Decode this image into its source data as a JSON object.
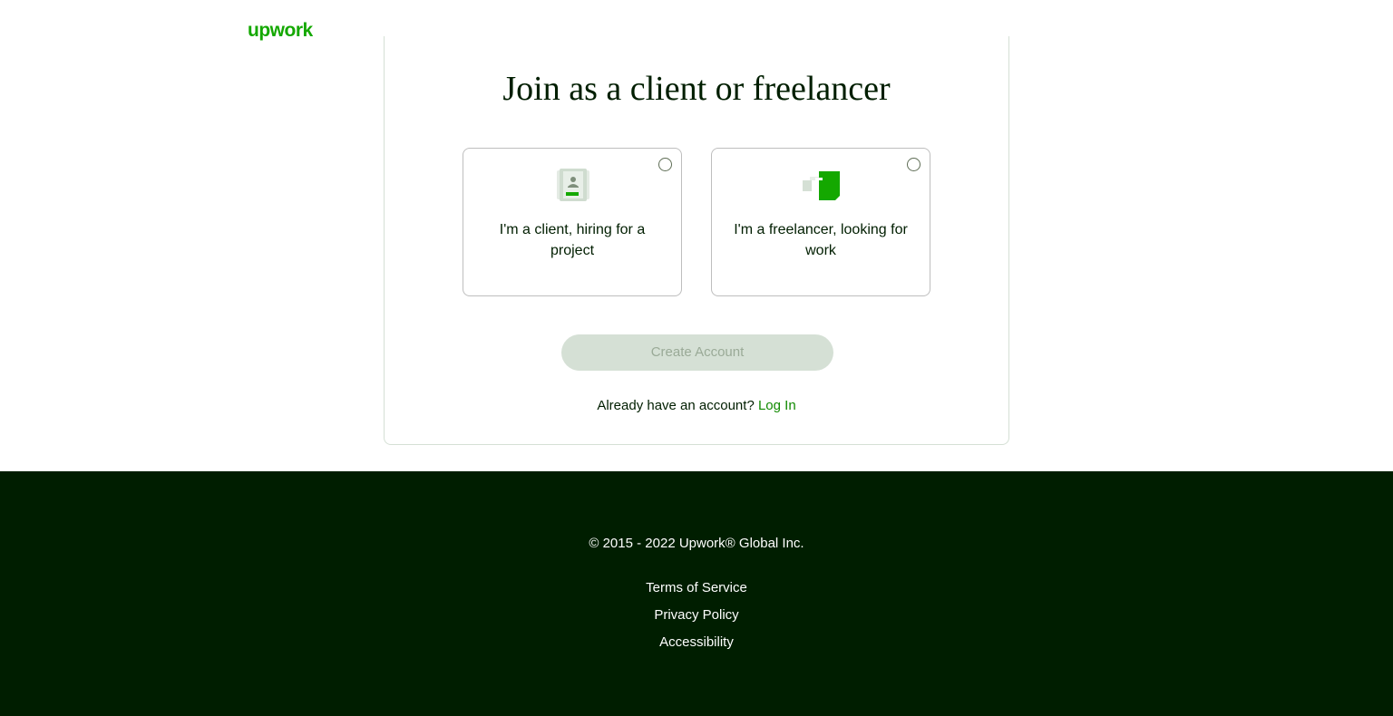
{
  "header": {
    "logo_text": "upwork"
  },
  "main": {
    "title": "Join as a client or freelancer",
    "options": [
      {
        "label": "I'm a client, hiring for a project",
        "icon": "client-briefcase-icon",
        "selected": false
      },
      {
        "label": "I'm a freelancer, looking for work",
        "icon": "freelancer-work-icon",
        "selected": false
      }
    ],
    "create_account_label": "Create Account",
    "login_prompt": "Already have an account?",
    "login_link": "Log In"
  },
  "footer": {
    "copyright": "© 2015 - 2022 Upwork® Global Inc.",
    "links": [
      "Terms of Service",
      "Privacy Policy",
      "Accessibility"
    ]
  },
  "colors": {
    "brand_green": "#14a800",
    "footer_bg": "#001e00",
    "disabled_button_bg": "#d5e0d5"
  }
}
